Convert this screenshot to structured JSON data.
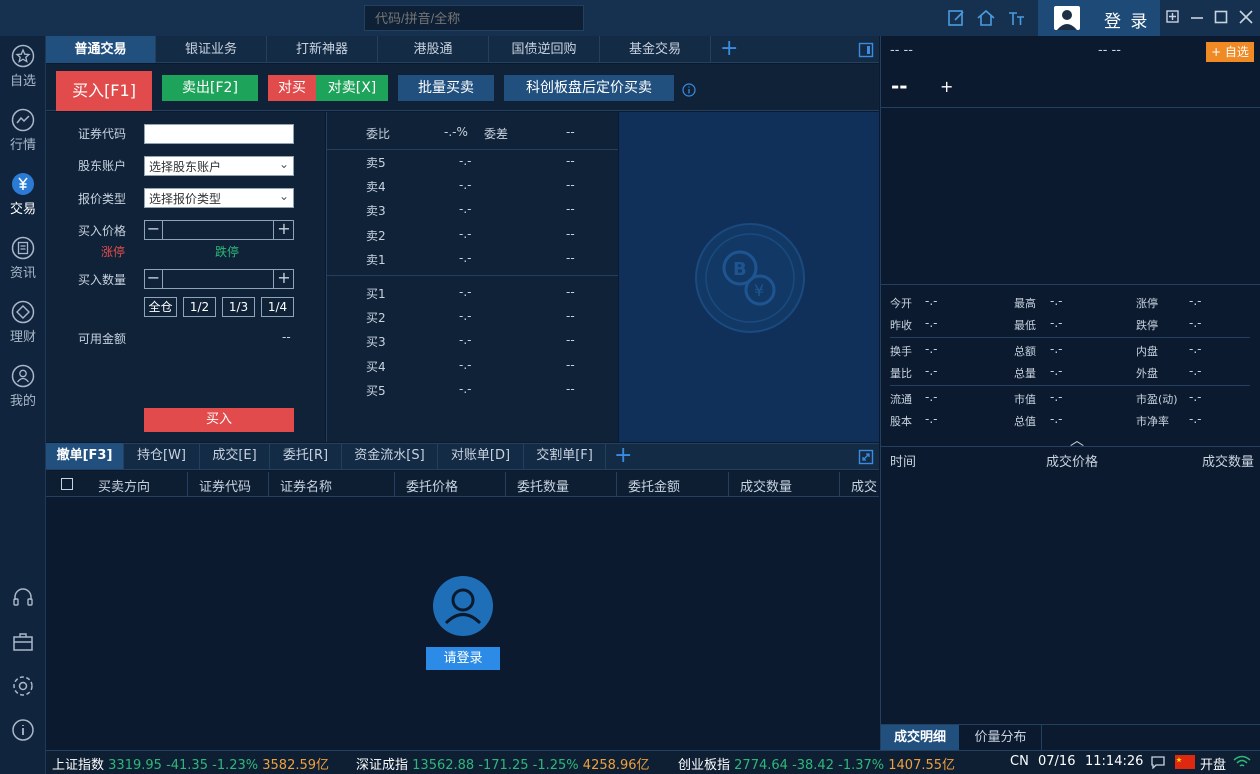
{
  "titlebar": {
    "search_placeholder": "代码/拼音/全称",
    "login_label": "登 录",
    "icons": [
      "edit-icon",
      "home-icon",
      "font-size-icon",
      "pin-icon",
      "minimize-icon",
      "maximize-icon",
      "close-icon"
    ]
  },
  "sidebar": {
    "items": [
      {
        "label": "自选",
        "icon": "star-icon"
      },
      {
        "label": "行情",
        "icon": "chart-line-icon"
      },
      {
        "label": "交易",
        "icon": "yuan-icon",
        "active": true
      },
      {
        "label": "资讯",
        "icon": "news-icon"
      },
      {
        "label": "理财",
        "icon": "diamond-icon"
      },
      {
        "label": "我的",
        "icon": "user-icon"
      }
    ],
    "bottom_icons": [
      "headset-icon",
      "toolbox-icon",
      "settings-icon",
      "info-icon"
    ]
  },
  "tabs": [
    {
      "label": "普通交易",
      "active": true
    },
    {
      "label": "银证业务"
    },
    {
      "label": "打新神器"
    },
    {
      "label": "港股通"
    },
    {
      "label": "国债逆回购"
    },
    {
      "label": "基金交易"
    }
  ],
  "actions": {
    "buy": "买入[F1]",
    "sell": "卖出[F2]",
    "cross_buy": "对买",
    "cross_sell": "对卖[X]",
    "batch": "批量买卖",
    "star_market": "科创板盘后定价买卖"
  },
  "form": {
    "code_label": "证券代码",
    "account_label": "股东账户",
    "account_value": "选择股东账户",
    "price_type_label": "报价类型",
    "price_type_value": "选择报价类型",
    "price_label": "买入价格",
    "limit_up": "涨停",
    "limit_down": "跌停",
    "qty_label": "买入数量",
    "qty_buttons": [
      "全仓",
      "1/2",
      "1/3",
      "1/4"
    ],
    "available_label": "可用金额",
    "available_value": "--",
    "submit": "买入"
  },
  "orderbook": {
    "ratio_label": "委比",
    "ratio_value": "-.-%",
    "diff_label": "委差",
    "diff_value": "--",
    "asks": [
      {
        "label": "卖5",
        "price": "-.-",
        "vol": "--"
      },
      {
        "label": "卖4",
        "price": "-.-",
        "vol": "--"
      },
      {
        "label": "卖3",
        "price": "-.-",
        "vol": "--"
      },
      {
        "label": "卖2",
        "price": "-.-",
        "vol": "--"
      },
      {
        "label": "卖1",
        "price": "-.-",
        "vol": "--"
      }
    ],
    "bids": [
      {
        "label": "买1",
        "price": "-.-",
        "vol": "--"
      },
      {
        "label": "买2",
        "price": "-.-",
        "vol": "--"
      },
      {
        "label": "买3",
        "price": "-.-",
        "vol": "--"
      },
      {
        "label": "买4",
        "price": "-.-",
        "vol": "--"
      },
      {
        "label": "买5",
        "price": "-.-",
        "vol": "--"
      }
    ]
  },
  "bottom_tabs": [
    {
      "label": "撤单[F3]",
      "active": true
    },
    {
      "label": "持仓[W]"
    },
    {
      "label": "成交[E]"
    },
    {
      "label": "委托[R]"
    },
    {
      "label": "资金流水[S]"
    },
    {
      "label": "对账单[D]"
    },
    {
      "label": "交割单[F]"
    }
  ],
  "table_columns": [
    "买卖方向",
    "证券代码",
    "证券名称",
    "委托价格",
    "委托数量",
    "委托金额",
    "成交数量",
    "成交"
  ],
  "login_prompt": "请登录",
  "right_panel": {
    "name_placeholder": "-- --",
    "price_placeholder": "-- --",
    "add_watch": "+ 自选",
    "dash_big": "--",
    "plus": "+",
    "quote_rows": [
      [
        [
          "今开",
          "-.-"
        ],
        [
          "最高",
          "-.-"
        ],
        [
          "涨停",
          "-.-"
        ]
      ],
      [
        [
          "昨收",
          "-.-"
        ],
        [
          "最低",
          "-.-"
        ],
        [
          "跌停",
          "-.-"
        ]
      ],
      [
        [
          "换手",
          "-.-"
        ],
        [
          "总额",
          "-.-"
        ],
        [
          "内盘",
          "-.-"
        ]
      ],
      [
        [
          "量比",
          "-.-"
        ],
        [
          "总量",
          "-.-"
        ],
        [
          "外盘",
          "-.-"
        ]
      ],
      [
        [
          "流通",
          "-.-"
        ],
        [
          "市值",
          "-.-"
        ],
        [
          "市盈(动)",
          "-.-"
        ]
      ],
      [
        [
          "股本",
          "-.-"
        ],
        [
          "总值",
          "-.-"
        ],
        [
          "市净率",
          "-.-"
        ]
      ]
    ],
    "detail_cols": [
      "时间",
      "成交价格",
      "成交数量"
    ],
    "detail_tabs": [
      {
        "label": "成交明细",
        "active": true
      },
      {
        "label": "价量分布"
      }
    ]
  },
  "statusbar": {
    "indices": [
      {
        "name": "上证指数",
        "value": "3319.95",
        "change": "-41.35",
        "pct": "-1.23%",
        "amount": "3582.59亿"
      },
      {
        "name": "深证成指",
        "value": "13562.88",
        "change": "-171.25",
        "pct": "-1.25%",
        "amount": "4258.96亿"
      },
      {
        "name": "创业板指",
        "value": "2774.64",
        "change": "-38.42",
        "pct": "-1.37%",
        "amount": "1407.55亿"
      }
    ],
    "region": "CN",
    "date": "07/16",
    "time": "11:14:26",
    "market_state": "开盘"
  },
  "colors": {
    "buy_red": "#e14b4b",
    "sell_green": "#1ea35b",
    "blue_btn": "#21507f",
    "accent_orange": "#f08a24"
  }
}
